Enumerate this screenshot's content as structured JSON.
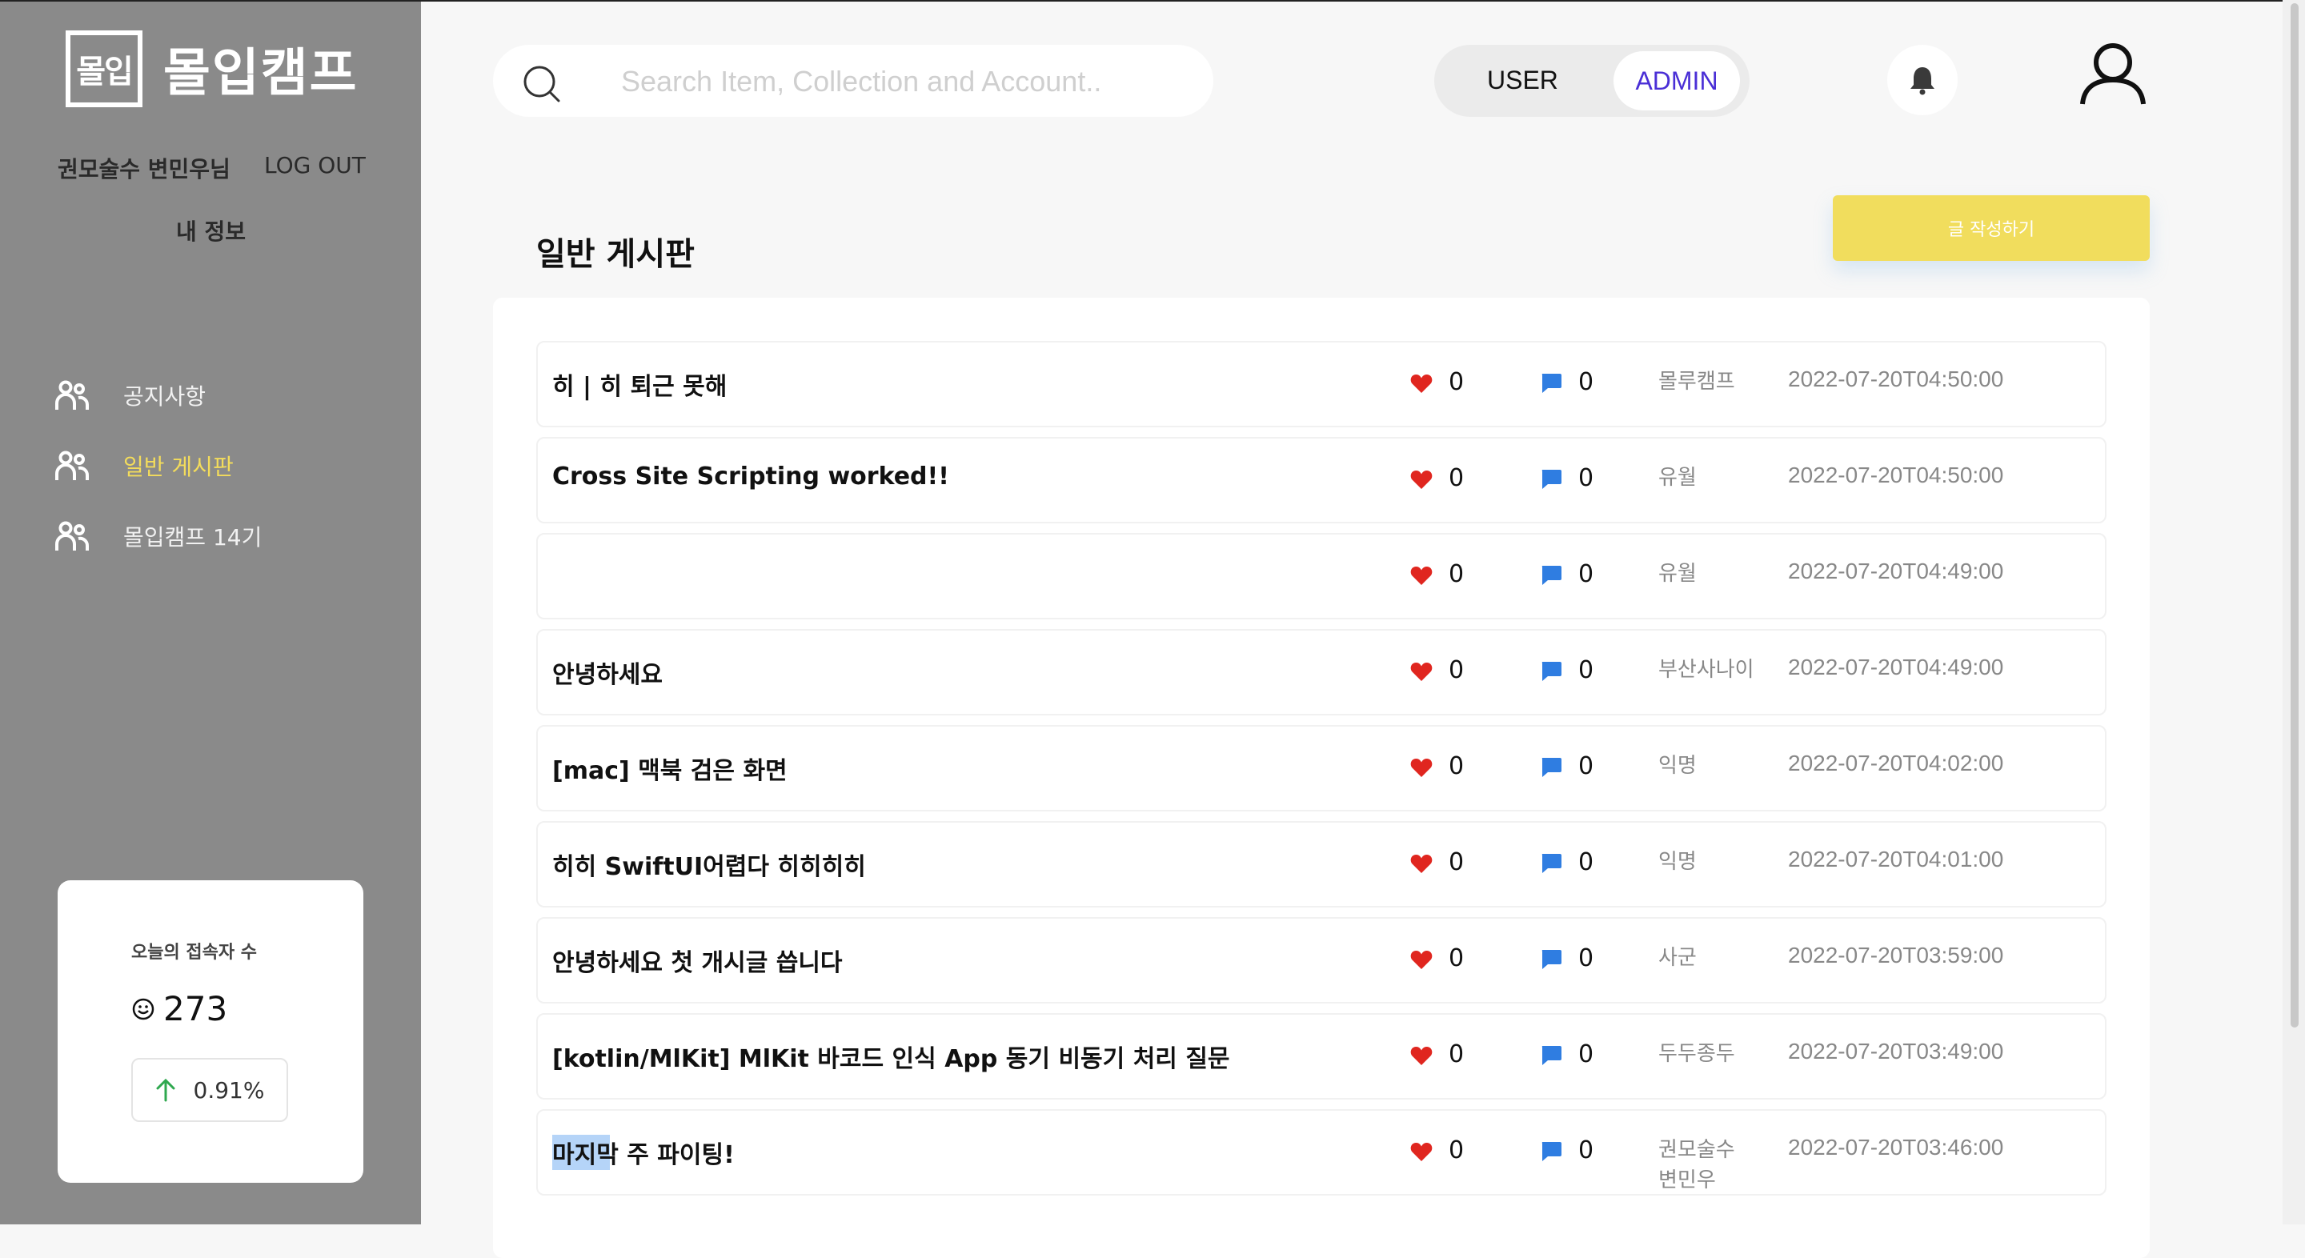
{
  "brand": {
    "logo_mark": "몰입",
    "name": "몰입캠프"
  },
  "account": {
    "name": "권모술수 변민우님",
    "logout": "LOG OUT",
    "my_info": "내 정보"
  },
  "nav": [
    {
      "label": "공지사항",
      "icon": "users-icon",
      "active": false
    },
    {
      "label": "일반 게시판",
      "icon": "users-icon",
      "active": true
    },
    {
      "label": "몰입캠프 14기",
      "icon": "users-icon",
      "active": false
    }
  ],
  "visitors": {
    "title": "오늘의 접속자 수",
    "count": "273",
    "rate": "0.91%",
    "trend": "up"
  },
  "search": {
    "placeholder": "Search Item, Collection and Account.."
  },
  "role": {
    "user": "USER",
    "admin": "ADMIN",
    "selected": "ADMIN"
  },
  "page": {
    "title": "일반 게시판",
    "write_button": "글 작성하기"
  },
  "posts": [
    {
      "title": "히 | 히 퇴근 못해",
      "likes": "0",
      "comments": "0",
      "author": "몰루캠프",
      "date": "2022-07-20T04:50:00"
    },
    {
      "title": "Cross Site Scripting worked!!",
      "likes": "0",
      "comments": "0",
      "author": "유월",
      "date": "2022-07-20T04:50:00"
    },
    {
      "title": "",
      "likes": "0",
      "comments": "0",
      "author": "유월",
      "date": "2022-07-20T04:49:00"
    },
    {
      "title": "안녕하세요",
      "likes": "0",
      "comments": "0",
      "author": "부산사나이",
      "date": "2022-07-20T04:49:00"
    },
    {
      "title": "[mac] 맥북 검은 화면",
      "likes": "0",
      "comments": "0",
      "author": "익명",
      "date": "2022-07-20T04:02:00"
    },
    {
      "title": "히히 SwiftUI어렵다 히히히히",
      "likes": "0",
      "comments": "0",
      "author": "익명",
      "date": "2022-07-20T04:01:00"
    },
    {
      "title": "안녕하세요 첫 개시글 씁니다",
      "likes": "0",
      "comments": "0",
      "author": "사군",
      "date": "2022-07-20T03:59:00"
    },
    {
      "title": "[kotlin/MlKit] MlKit 바코드 인식 App 동기 비동기 처리 질문",
      "likes": "0",
      "comments": "0",
      "author": "두두종두",
      "date": "2022-07-20T03:49:00"
    },
    {
      "title": "마지막 주 파이팅!",
      "likes": "0",
      "comments": "0",
      "author": "권모술수 변민우",
      "date": "2022-07-20T03:46:00"
    }
  ],
  "colors": {
    "sidebar": "#8a8a8a",
    "accent_yellow": "#f1dd5d",
    "admin_text": "#4a2fd6",
    "heart": "#e0261f",
    "chat": "#2f7de1"
  }
}
